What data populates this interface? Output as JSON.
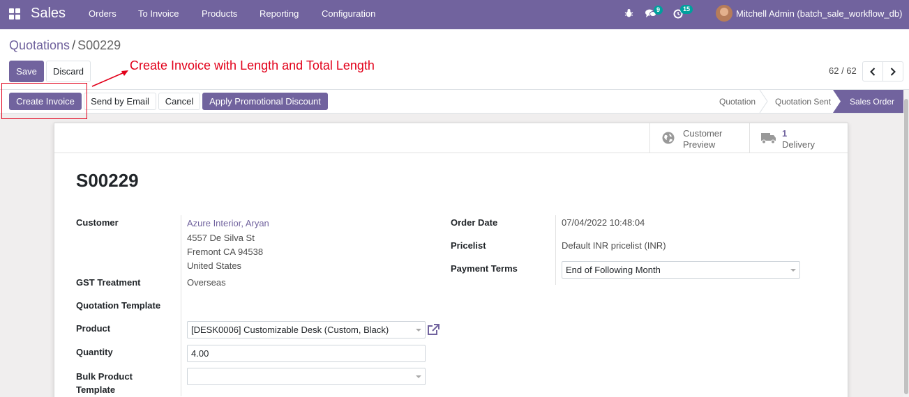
{
  "navbar": {
    "brand": "Sales",
    "menu": [
      "Orders",
      "To Invoice",
      "Products",
      "Reporting",
      "Configuration"
    ],
    "messages_badge": "9",
    "activity_badge": "15",
    "user": "Mitchell Admin (batch_sale_workflow_db)"
  },
  "breadcrumb": {
    "parent": "Quotations",
    "separator": "/",
    "current": "S00229"
  },
  "toolbar": {
    "save": "Save",
    "discard": "Discard"
  },
  "annotation": "Create Invoice with Length and Total Length",
  "pager": {
    "value": "62 / 62"
  },
  "actions": {
    "create_invoice": "Create Invoice",
    "send_email": "Send by Email",
    "cancel": "Cancel",
    "promo": "Apply Promotional Discount"
  },
  "stages": {
    "quotation": "Quotation",
    "sent": "Quotation Sent",
    "sale": "Sales Order"
  },
  "smart_buttons": {
    "preview_line1": "Customer",
    "preview_line2": "Preview",
    "delivery_count": "1",
    "delivery_label": "Delivery"
  },
  "record": {
    "name": "S00229"
  },
  "fields": {
    "customer_label": "Customer",
    "customer_name": "Azure Interior, Aryan",
    "address_line1": "4557 De Silva St",
    "address_line2": "Fremont CA 94538",
    "address_line3": "United States",
    "gst_label": "GST Treatment",
    "gst_value": "Overseas",
    "template_label": "Quotation Template",
    "product_label": "Product",
    "product_value": "[DESK0006] Customizable Desk (Custom, Black)",
    "quantity_label": "Quantity",
    "quantity_value": "4.00",
    "bulk_label_1": "Bulk Product",
    "bulk_label_2": "Template",
    "order_date_label": "Order Date",
    "order_date_value": "07/04/2022 10:48:04",
    "pricelist_label": "Pricelist",
    "pricelist_value": "Default INR pricelist (INR)",
    "payment_terms_label": "Payment Terms",
    "payment_terms_value": "End of Following Month"
  }
}
